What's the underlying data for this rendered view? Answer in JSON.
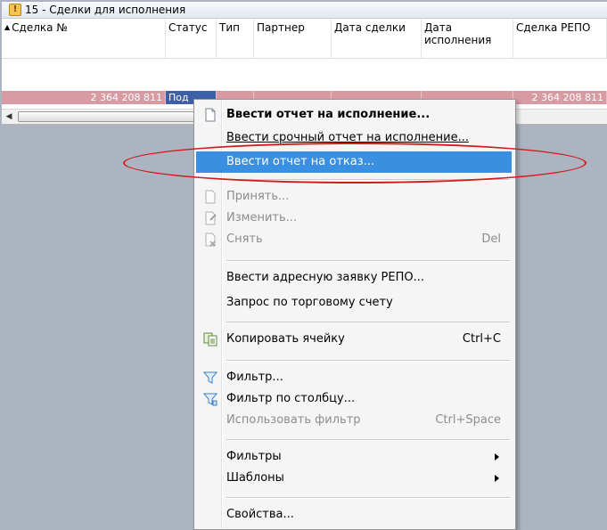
{
  "window": {
    "title": "15 - Сделки для исполнения",
    "icon": "warning-icon"
  },
  "columns": [
    "Сделка №",
    "Статус",
    "Тип",
    "Партнер",
    "Дата сделки",
    "Дата исполнения",
    "Сделка РЕПО"
  ],
  "row": {
    "deal_no": "2 364 208 811",
    "status": "Под",
    "type": "",
    "partner": "",
    "deal_date": "",
    "exec_date": "",
    "repo_deal": "2 364 208 811"
  },
  "menu": {
    "items": [
      {
        "label": "Ввести отчет на исполнение...",
        "icon": "document-icon"
      },
      {
        "label": "Ввести срочный отчет на исполнение..."
      },
      {
        "label": "Ввести отчет на отказ..."
      },
      {
        "label": "Принять...",
        "icon": "document-icon"
      },
      {
        "label": "Изменить...",
        "icon": "edit-icon"
      },
      {
        "label": "Снять",
        "shortcut": "Del",
        "icon": "remove-icon"
      },
      {
        "label": "Ввести адресную заявку РЕПО..."
      },
      {
        "label": "Запрос по торговому счету"
      },
      {
        "label": "Копировать ячейку",
        "shortcut": "Ctrl+C",
        "icon": "copy-icon"
      },
      {
        "label": "Фильтр...",
        "icon": "filter-icon"
      },
      {
        "label": "Фильтр по столбцу...",
        "icon": "column-filter-icon"
      },
      {
        "label": "Использовать фильтр",
        "shortcut": "Ctrl+Space"
      },
      {
        "label": "Фильтры"
      },
      {
        "label": "Шаблоны"
      },
      {
        "label": "Свойства..."
      }
    ]
  },
  "colors": {
    "highlight": "#3a8fe0",
    "row": "#d89aa3",
    "annotation": "#d21c1c"
  }
}
